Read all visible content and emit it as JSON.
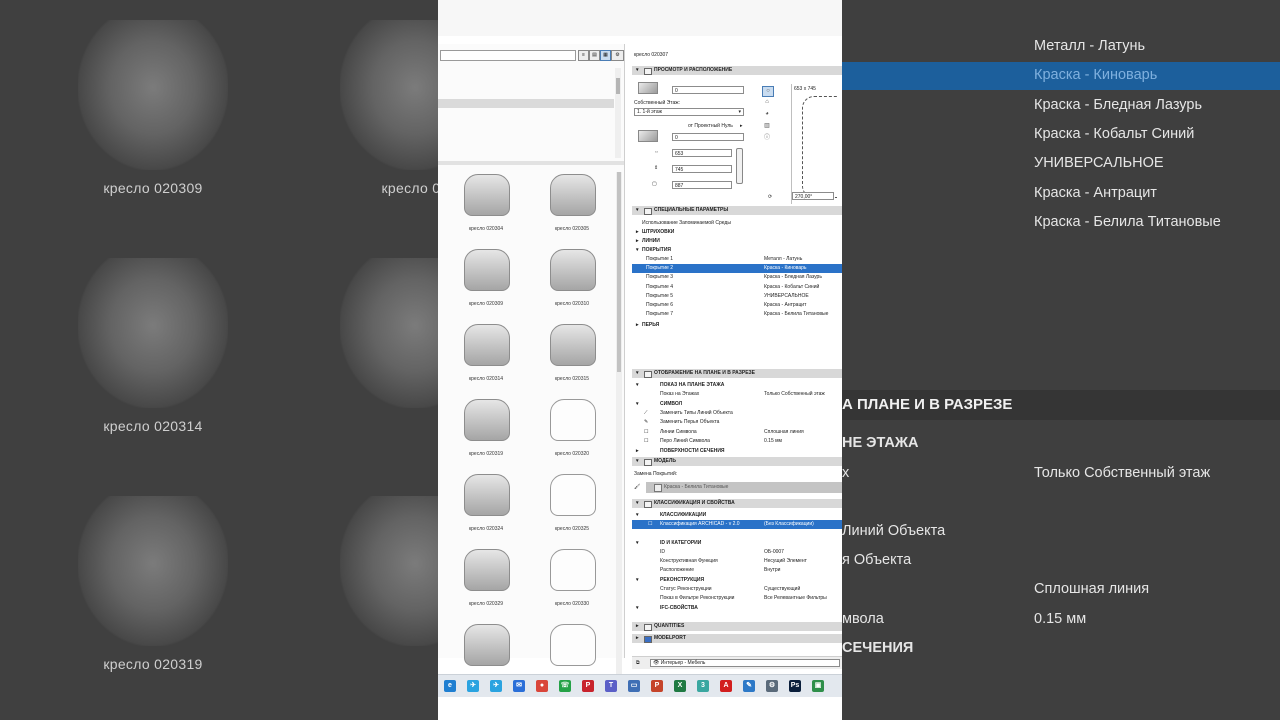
{
  "background_left": {
    "captions": [
      "кресло 020309",
      "кресло 02",
      "кресло 020314",
      "кресло 020319"
    ]
  },
  "background_right": {
    "rows_top": [
      "Металл - Латунь",
      "Краска - Киноварь",
      "Краска - Бледная Лазурь",
      "Краска - Кобальт Синий",
      "УНИВЕРСАЛЬНОЕ",
      "Краска - Антрацит",
      "Краска - Белила Титановые"
    ],
    "section_head": "А ПЛАНЕ И В РАЗРЕЗЕ",
    "sub_head": "НЕ ЭТАЖА",
    "show_left": "х",
    "show_value": "Только Собственный этаж",
    "replace_lines": "Линий Объекта",
    "replace_pens": "я Объекта",
    "line_value": "Сплошная линия",
    "pen_left": "мвола",
    "pen_value": "0.15 мм",
    "sections_label": "СЕЧЕНИЯ"
  },
  "library": {
    "items": [
      {
        "caption": "кресло 020304",
        "style": "solid"
      },
      {
        "caption": "кресло 020305",
        "style": "solid"
      },
      {
        "caption": "кресло 020309",
        "style": "solid"
      },
      {
        "caption": "кресло 020310",
        "style": "solid"
      },
      {
        "caption": "кресло 020314",
        "style": "solid"
      },
      {
        "caption": "кресло 020315",
        "style": "solid"
      },
      {
        "caption": "кресло 020319",
        "style": "solid"
      },
      {
        "caption": "кресло 020320",
        "style": "wire"
      },
      {
        "caption": "кресло 020324",
        "style": "solid"
      },
      {
        "caption": "кресло 020325",
        "style": "wire"
      },
      {
        "caption": "кресло 020329",
        "style": "solid"
      },
      {
        "caption": "кресло 020330",
        "style": "wire"
      },
      {
        "caption": "",
        "style": "solid"
      },
      {
        "caption": "",
        "style": "wire"
      }
    ]
  },
  "settings": {
    "object_name": "кресло 020307",
    "sec_view": "ПРОСМОТР И РАСПОЛОЖЕНИЕ",
    "elevation_value": "0",
    "home_story_label": "Собственный Этаж:",
    "home_story_value": "1. 1-й этаж",
    "project_zero": "от Проектный Нуль",
    "offset_value": "0",
    "dim_a": "653",
    "dim_b": "745",
    "dim_c": "887",
    "preview_size": "653 x 745",
    "rotation": "270,00°",
    "sec_special": "СПЕЦИАЛЬНЫЕ ПАРАМЕТРЫ",
    "use_memory": "Использование Запоминаемой Среды",
    "hatching": "ШТРИХОВКИ",
    "lines": "ЛИНИИ",
    "surfaces": "ПОКРЫТИЯ",
    "surface_rows": [
      {
        "k": "Покрытие 1",
        "v": "Металл - Латунь"
      },
      {
        "k": "Покрытие 2",
        "v": "Краска - Киноварь"
      },
      {
        "k": "Покрытие 3",
        "v": "Краска - Бледная Лазурь"
      },
      {
        "k": "Покрытие 4",
        "v": "Краска - Кобальт Синий"
      },
      {
        "k": "Покрытие 5",
        "v": "УНИВЕРСАЛЬНОЕ"
      },
      {
        "k": "Покрытие 6",
        "v": "Краска - Антрацит"
      },
      {
        "k": "Покрытие 7",
        "v": "Краска - Белила Титановые"
      }
    ],
    "pens": "ПЕРЬЯ",
    "sec_plan": "ОТОБРАЖЕНИЕ НА ПЛАНЕ И В РАЗРЕЗЕ",
    "plan_show": "ПОКАЗ НА ПЛАНЕ ЭТАЖА",
    "show_on_stories": "Показ на Этажах",
    "show_on_stories_value": "Только Собственный этаж",
    "symbol": "СИМВОЛ",
    "override_lines": "Заменить Типы Линий Объекта",
    "override_pens": "Заменить Перья Объекта",
    "symbol_line": "Линии Символа",
    "symbol_line_value": "Сплошная линия",
    "symbol_pen": "Перо Линий Символа",
    "symbol_pen_value": "0.15 мм",
    "cut_surfaces": "ПОВЕРХНОСТИ СЕЧЕНИЯ",
    "sec_model": "МОДЕЛЬ",
    "override_surface": "Замена Покрытий:",
    "paint_value": "Краска - Белила Титановые",
    "sec_class": "КЛАССИФИКАЦИЯ И СВОЙСТВА",
    "classifications": "КЛАССИФИКАЦИИ",
    "class_row_k": "Классификация ARCHICAD - v 2.0",
    "class_row_v": "(Без Классификации)",
    "id_cat": "ID И КАТЕГОРИИ",
    "id_rows": [
      {
        "k": "ID",
        "v": "ОБ-0007"
      },
      {
        "k": "Конструктивная Функция",
        "v": "Несущий Элемент"
      },
      {
        "k": "Расположение",
        "v": "Внутри"
      }
    ],
    "renovation": "РЕКОНСТРУКЦИЯ",
    "reno_rows": [
      {
        "k": "Статус Реконструкции",
        "v": "Существующий"
      },
      {
        "k": "Показ в Фильтре Реконструкции",
        "v": "Все Релевантные Фильтры"
      }
    ],
    "ifc": "IFC-СВОЙСТВА",
    "quantities": "QUANTITIES",
    "modelport": "MODELPORT",
    "layer": "Интерьер - Мебель"
  },
  "taskbar": {
    "icons": [
      {
        "name": "edge-icon",
        "color": "#1f7fd1",
        "glyph": "e"
      },
      {
        "name": "telegram-icon",
        "color": "#2aa3e0",
        "glyph": "✈"
      },
      {
        "name": "telegram2-icon",
        "color": "#2aa3e0",
        "glyph": "✈"
      },
      {
        "name": "mail-icon",
        "color": "#2b6fd8",
        "glyph": "✉"
      },
      {
        "name": "chrome-icon",
        "color": "#d9463a",
        "glyph": "●"
      },
      {
        "name": "whatsapp-icon",
        "color": "#25a247",
        "glyph": "☏"
      },
      {
        "name": "pinterest-icon",
        "color": "#c8232c",
        "glyph": "P"
      },
      {
        "name": "teams-icon",
        "color": "#5b5fc7",
        "glyph": "T"
      },
      {
        "name": "desktop-icon",
        "color": "#3f6fb5",
        "glyph": "▭"
      },
      {
        "name": "powerpoint-icon",
        "color": "#c5442a",
        "glyph": "P"
      },
      {
        "name": "excel-icon",
        "color": "#1f7a43",
        "glyph": "X"
      },
      {
        "name": "app-icon",
        "color": "#3aa7a0",
        "glyph": "3"
      },
      {
        "name": "acrobat-icon",
        "color": "#d21e1e",
        "glyph": "A"
      },
      {
        "name": "paint-icon",
        "color": "#2d79c7",
        "glyph": "✎"
      },
      {
        "name": "tools-icon",
        "color": "#5a6a7a",
        "glyph": "⚙"
      },
      {
        "name": "photoshop-icon",
        "color": "#0b1f3b",
        "glyph": "Ps"
      },
      {
        "name": "archicad-icon",
        "color": "#2f8f4a",
        "glyph": "▣"
      }
    ]
  }
}
